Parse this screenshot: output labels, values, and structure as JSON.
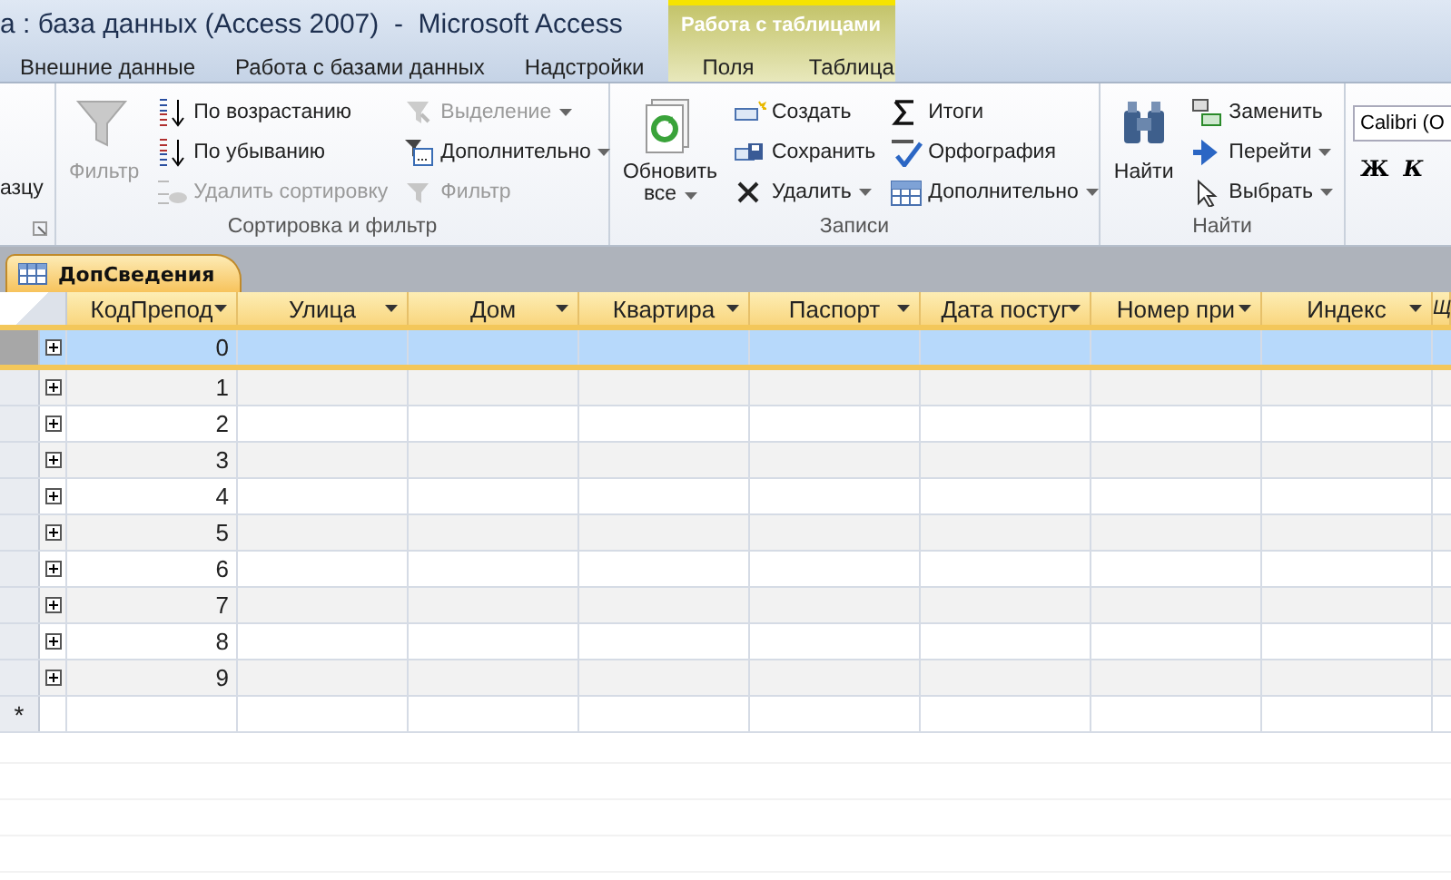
{
  "window": {
    "title": "а : база данных (Access 2007)  -  Microsoft Access"
  },
  "context_group": {
    "label": "Работа с таблицами"
  },
  "tabs": [
    {
      "label": "Внешние данные",
      "selected": false,
      "context": false
    },
    {
      "label": "Работа с базами данных",
      "selected": false,
      "context": false
    },
    {
      "label": "Надстройки",
      "selected": false,
      "context": false
    },
    {
      "label": "Поля",
      "selected": false,
      "context": true
    },
    {
      "label": "Таблица",
      "selected": false,
      "context": true
    }
  ],
  "ribbon": {
    "partial_group": {
      "text": "азцу"
    },
    "groups": [
      {
        "label": "Сортировка и фильтр",
        "large": {
          "label": "Фильтр",
          "disabled": true,
          "dropdown": false
        },
        "columns": [
          [
            {
              "label": "По возрастанию",
              "disabled": false,
              "dropdown": false
            },
            {
              "label": "По убыванию",
              "disabled": false,
              "dropdown": false
            },
            {
              "label": "Удалить сортировку",
              "disabled": true,
              "dropdown": false
            }
          ],
          [
            {
              "label": "Выделение",
              "disabled": true,
              "dropdown": true
            },
            {
              "label": "Дополнительно",
              "disabled": false,
              "dropdown": true
            },
            {
              "label": "Фильтр",
              "disabled": true,
              "dropdown": false
            }
          ]
        ]
      },
      {
        "label": "Записи",
        "large": {
          "label": "Обновить все",
          "disabled": false,
          "dropdown": true
        },
        "columns": [
          [
            {
              "label": "Создать",
              "disabled": false,
              "dropdown": false
            },
            {
              "label": "Сохранить",
              "disabled": false,
              "dropdown": false
            },
            {
              "label": "Удалить",
              "disabled": false,
              "dropdown": true
            }
          ],
          [
            {
              "label": "Итоги",
              "disabled": false,
              "dropdown": false
            },
            {
              "label": "Орфография",
              "disabled": false,
              "dropdown": false
            },
            {
              "label": "Дополнительно",
              "disabled": false,
              "dropdown": true
            }
          ]
        ]
      },
      {
        "label": "Найти",
        "large": {
          "label": "Найти",
          "disabled": false,
          "dropdown": false
        },
        "columns": [
          [
            {
              "label": "Заменить",
              "disabled": false,
              "dropdown": false
            },
            {
              "label": "Перейти",
              "disabled": false,
              "dropdown": true
            },
            {
              "label": "Выбрать",
              "disabled": false,
              "dropdown": true
            }
          ]
        ]
      }
    ],
    "font": {
      "value": "Calibri (О",
      "buttons": [
        "Ж",
        "К"
      ]
    }
  },
  "document_tab": {
    "label": "ДопСведения",
    "selected": true
  },
  "table": {
    "columns": [
      {
        "label": "КодПрепод",
        "dropdown": true
      },
      {
        "label": "Улица",
        "dropdown": true
      },
      {
        "label": "Дом",
        "dropdown": true
      },
      {
        "label": "Квартира",
        "dropdown": true
      },
      {
        "label": "Паспорт",
        "dropdown": true
      },
      {
        "label": "Дата постуг",
        "dropdown": true
      },
      {
        "label": "Номер при",
        "dropdown": true
      },
      {
        "label": "Индекс",
        "dropdown": true
      },
      {
        "label": "Щ"
      }
    ],
    "rows": [
      {
        "code": "0",
        "selected": true
      },
      {
        "code": "1",
        "selected": false
      },
      {
        "code": "2",
        "selected": false
      },
      {
        "code": "3",
        "selected": false
      },
      {
        "code": "4",
        "selected": false
      },
      {
        "code": "5",
        "selected": false
      },
      {
        "code": "6",
        "selected": false
      },
      {
        "code": "7",
        "selected": false
      },
      {
        "code": "8",
        "selected": false
      },
      {
        "code": "9",
        "selected": false
      }
    ],
    "new_row_marker": "*"
  }
}
